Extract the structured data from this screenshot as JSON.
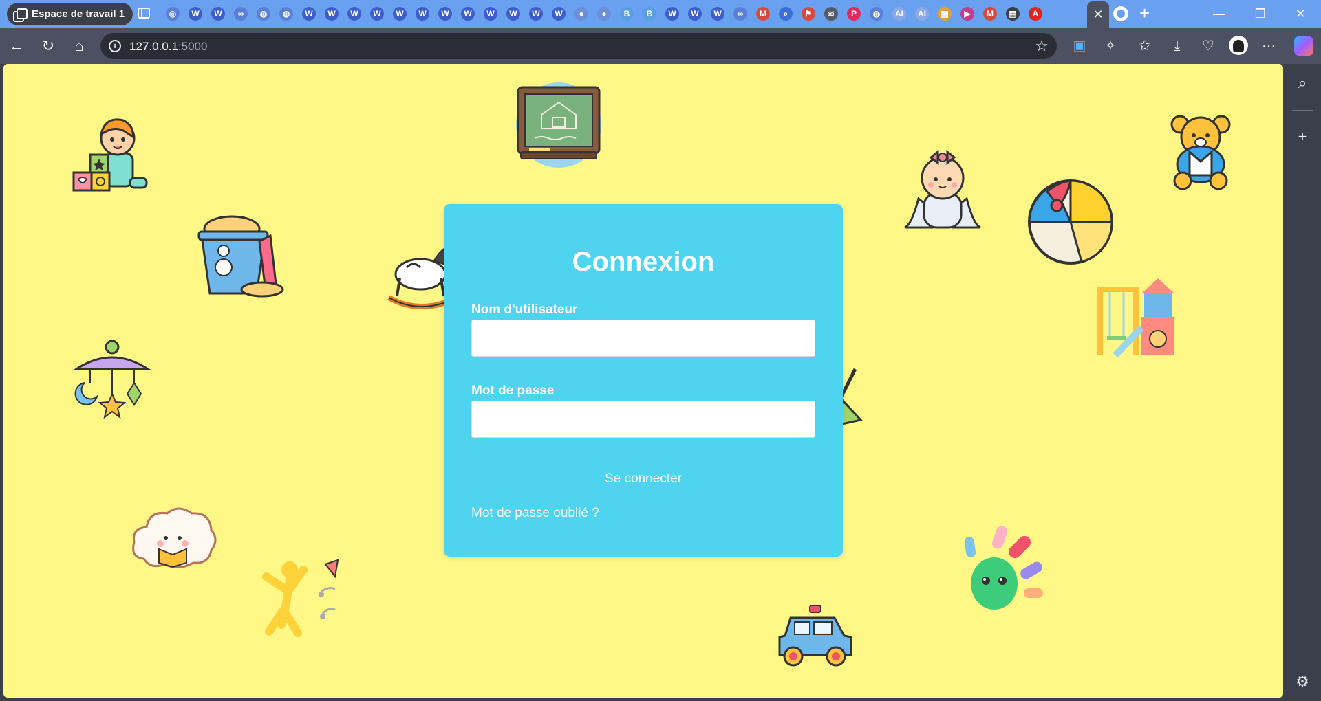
{
  "browser": {
    "workspace_label": "Espace de travail 1",
    "pinned_favicons": [
      {
        "icon": "globe-icon",
        "glyph": "◎",
        "color": "#5b7fd6"
      },
      {
        "icon": "wordpress-icon",
        "glyph": "W",
        "color": "#3d5ec9"
      },
      {
        "icon": "wordpress-icon",
        "glyph": "W",
        "color": "#3d5ec9"
      },
      {
        "icon": "meta-icon",
        "glyph": "∞",
        "color": "#5b7fd6"
      },
      {
        "icon": "globe-icon",
        "glyph": "◍",
        "color": "#5b7fd6"
      },
      {
        "icon": "globe-icon",
        "glyph": "◍",
        "color": "#5b7fd6"
      },
      {
        "icon": "wordpress-icon",
        "glyph": "W",
        "color": "#3d5ec9"
      },
      {
        "icon": "wordpress-icon",
        "glyph": "W",
        "color": "#3d5ec9"
      },
      {
        "icon": "wordpress-icon",
        "glyph": "W",
        "color": "#3d5ec9"
      },
      {
        "icon": "wordpress-icon",
        "glyph": "W",
        "color": "#3d5ec9"
      },
      {
        "icon": "wordpress-icon",
        "glyph": "W",
        "color": "#3d5ec9"
      },
      {
        "icon": "wordpress-icon",
        "glyph": "W",
        "color": "#3d5ec9"
      },
      {
        "icon": "wordpress-icon",
        "glyph": "W",
        "color": "#3d5ec9"
      },
      {
        "icon": "wordpress-icon",
        "glyph": "W",
        "color": "#3d5ec9"
      },
      {
        "icon": "wordpress-icon",
        "glyph": "W",
        "color": "#3d5ec9"
      },
      {
        "icon": "wordpress-icon",
        "glyph": "W",
        "color": "#3d5ec9"
      },
      {
        "icon": "wordpress-icon",
        "glyph": "W",
        "color": "#3d5ec9"
      },
      {
        "icon": "wordpress-icon",
        "glyph": "W",
        "color": "#3d5ec9"
      },
      {
        "icon": "drop-icon",
        "glyph": "●",
        "color": "#6d8fd8"
      },
      {
        "icon": "drop-icon",
        "glyph": "●",
        "color": "#6d8fd8"
      },
      {
        "icon": "bootstrap-icon",
        "glyph": "B",
        "color": "#5a9fe0"
      },
      {
        "icon": "bootstrap-icon",
        "glyph": "B",
        "color": "#5a9fe0"
      },
      {
        "icon": "wordpress-icon",
        "glyph": "W",
        "color": "#3d5ec9"
      },
      {
        "icon": "wordpress-icon",
        "glyph": "W",
        "color": "#3d5ec9"
      },
      {
        "icon": "wordpress-icon",
        "glyph": "W",
        "color": "#3d5ec9"
      },
      {
        "icon": "meta-icon",
        "glyph": "∞",
        "color": "#5b7fd6"
      },
      {
        "icon": "gmail-icon",
        "glyph": "M",
        "color": "#d64a3b"
      },
      {
        "icon": "search-icon",
        "glyph": "⌕",
        "color": "#3b6fd6"
      },
      {
        "icon": "maps-icon",
        "glyph": "⚑",
        "color": "#d64a3b"
      },
      {
        "icon": "stack-icon",
        "glyph": "≋",
        "color": "#555b66"
      },
      {
        "icon": "pinterest-icon",
        "glyph": "P",
        "color": "#e02a5f"
      },
      {
        "icon": "globe-icon",
        "glyph": "◍",
        "color": "#5b7fd6"
      },
      {
        "icon": "ai-icon",
        "glyph": "AI",
        "color": "#8aa7e6"
      },
      {
        "icon": "ai-icon",
        "glyph": "AI",
        "color": "#8aa7e6"
      },
      {
        "icon": "grid-icon",
        "glyph": "▦",
        "color": "#e0a13a"
      },
      {
        "icon": "youtube-icon",
        "glyph": "▶",
        "color": "#c23b8d"
      },
      {
        "icon": "gmail-icon",
        "glyph": "M",
        "color": "#d64a3b"
      },
      {
        "icon": "calendar-icon",
        "glyph": "▤",
        "color": "#3b3f48"
      },
      {
        "icon": "adobe-icon",
        "glyph": "A",
        "color": "#e1251b"
      }
    ],
    "close_tab_glyph": "✕",
    "new_tab_glyph": "+",
    "window_controls": {
      "minimize": "—",
      "restore": "❐",
      "close": "✕"
    },
    "url_host": "127.0.0.1",
    "url_port": ":5000",
    "toolbar_glyphs": {
      "back": "←",
      "reload": "↻",
      "home": "⌂",
      "star": "☆",
      "extensions": "✧",
      "favorites": "✩",
      "downloads": "⤓",
      "health": "♡",
      "more": "···"
    },
    "side_glyphs": {
      "search": "⌕",
      "add": "+",
      "settings": "⚙"
    }
  },
  "login": {
    "title": "Connexion",
    "username_label": "Nom d'utilisateur",
    "username_value": "",
    "password_label": "Mot de passe",
    "password_value": "",
    "submit_label": "Se connecter",
    "forgot_label": "Mot de passe oublié ?"
  },
  "colors": {
    "page_background": "#fff886",
    "card_background": "#4fd4ef",
    "text_on_card": "#ffffff",
    "tab_strip": "#6aa0f0",
    "toolbar": "#4b5161"
  },
  "illustrations": [
    "boy-with-blocks-icon",
    "chalkboard-house-icon",
    "baby-girl-icon",
    "teddy-bear-icon",
    "sand-bucket-icon",
    "rocking-horse-icon",
    "beach-ball-icon",
    "playground-icon",
    "baby-mobile-icon",
    "easel-icon",
    "cloud-reading-icon",
    "jumping-child-icon",
    "toy-car-icon",
    "hand-paint-icon"
  ]
}
